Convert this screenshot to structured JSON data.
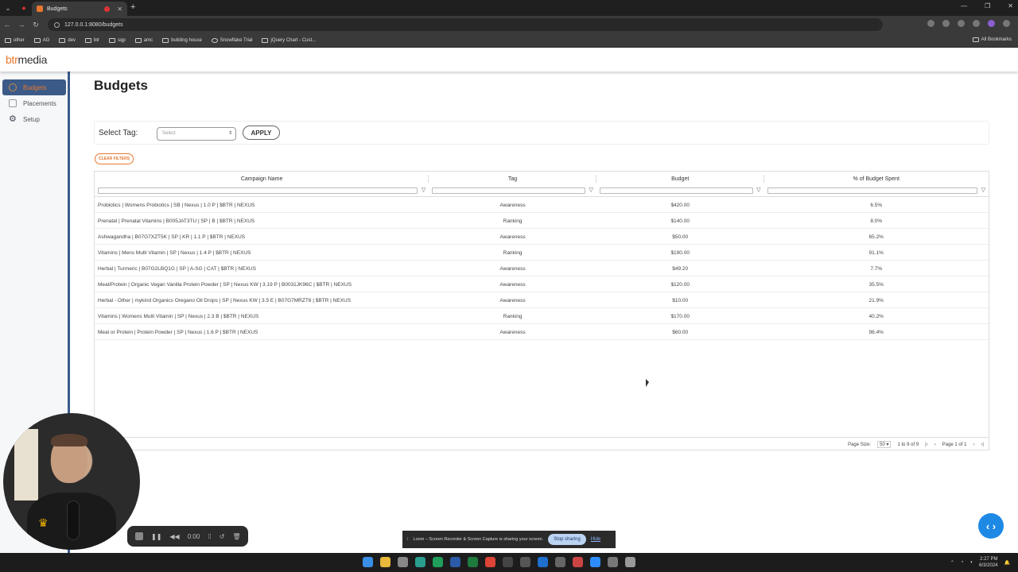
{
  "browser": {
    "tab_title": "Budgets",
    "url": "127.0.0.1:8080/budgets",
    "bookmarks": [
      "other",
      "AG",
      "dev",
      "btr",
      "sqp",
      "amc",
      "building house",
      "Snowflake Trial",
      "jQuery Chart - Cust..."
    ],
    "all_bookmarks": "All Bookmarks"
  },
  "app": {
    "logo_part1": "btr",
    "logo_part2": "media"
  },
  "sidebar": {
    "items": [
      {
        "label": "Budgets",
        "icon": "dollar-icon",
        "active": true
      },
      {
        "label": "Placements",
        "icon": "placements-icon",
        "active": false
      },
      {
        "label": "Setup",
        "icon": "gear-icon",
        "active": false
      }
    ]
  },
  "page": {
    "title": "Budgets",
    "select_label": "Select Tag:",
    "select_placeholder": "Select",
    "apply_label": "APPLY",
    "clear_filters_label": "CLEAR FILTERS"
  },
  "grid": {
    "columns": [
      "Campaign Name",
      "Tag",
      "Budget",
      "% of Budget Spent"
    ],
    "rows": [
      [
        "Probiotics | Womens Probiotics | SB | Nexus | 1.0 P | $BTR | NEXUS",
        "Awareness",
        "$420.00",
        "6.5%"
      ],
      [
        "Prenatal | Prenatal Vitamins | B005JAT3TU | SP | B | $BTR | NEXUS",
        "Ranking",
        "$140.00",
        "8.0%"
      ],
      [
        "Ashwagandha | B07G7XZT5K | SP | KR | 1.1 P | $BTR | NEXUS",
        "Awareness",
        "$50.00",
        "65.2%"
      ],
      [
        "Vitamins | Mens Multi Vitamin | SP | Nexus | 1.4 P | $BTR | NEXUS",
        "Ranking",
        "$190.00",
        "91.1%"
      ],
      [
        "Herbal | Turmeric | B07G2LBQ1G | SP | A-SG | CAT | $BTR | NEXUS",
        "Awareness",
        "$49.20",
        "7.7%"
      ],
      [
        "Meal/Protein | Organic Vegan Vanilla Protein Powder | SP | Nexus KW | 3.19 P | B0031JK96C | $BTR | NEXUS",
        "Awareness",
        "$120.00",
        "35.5%"
      ],
      [
        "Herbal - Other | mykind Organics Oregano Oil Drops | SP | Nexus KW | 3.5 E | B07G7MRZT6 | $BTR | NEXUS",
        "Awareness",
        "$10.00",
        "21.9%"
      ],
      [
        "Vitamins | Womens Multi Vitamin | SP | Nexus | 2.3 B | $BTR | NEXUS",
        "Ranking",
        "$170.00",
        "40.2%"
      ],
      [
        "Meal or Protein | Protein Powder | SP | Nexus | 1.6 P | $BTR | NEXUS",
        "Awareness",
        "$60.00",
        "98.4%"
      ]
    ],
    "footer": {
      "page_size_label": "Page Size:",
      "page_size": "50",
      "range_text": "1 to 9 of 9",
      "page_text": "Page 1 of 1"
    }
  },
  "overlays": {
    "rec_time": "0:00",
    "loom_text": "Loom – Screen Recorder & Screen Capture is sharing your screen.",
    "stop_sharing": "Stop sharing",
    "hide": "Hide"
  },
  "taskbar": {
    "time": "2:27 PM",
    "date": "6/3/2024"
  }
}
